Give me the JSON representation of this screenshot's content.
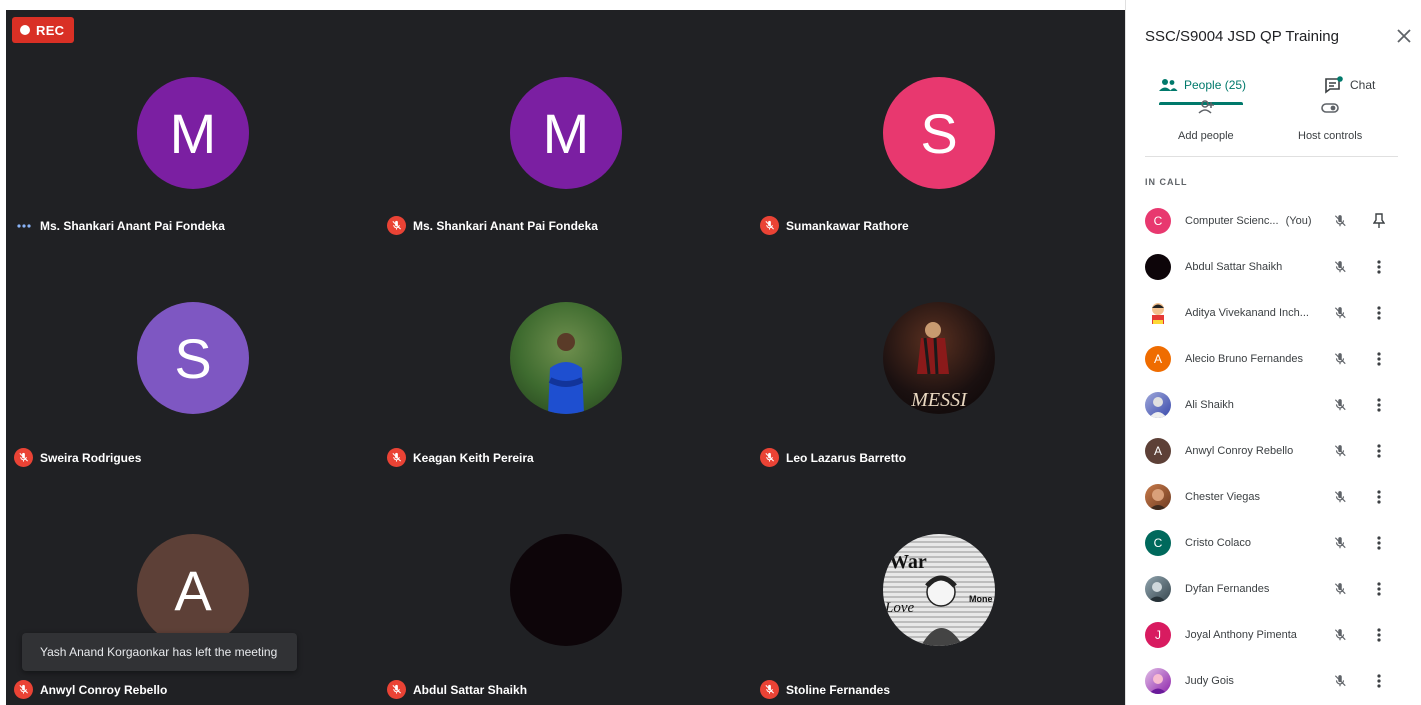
{
  "recording": {
    "label": "REC"
  },
  "tiles": [
    {
      "name": "Ms. Shankari Anant Pai Fondeka",
      "initial": "M",
      "color": "#7b1fa2",
      "status": "speaking"
    },
    {
      "name": "Ms. Shankari Anant Pai Fondeka",
      "initial": "M",
      "color": "#7b1fa2",
      "status": "muted"
    },
    {
      "name": "Sumankawar Rathore",
      "initial": "S",
      "color": "#e8386f",
      "status": "muted"
    },
    {
      "name": "Sweira Rodrigues",
      "initial": "S",
      "color": "#7e57c2",
      "status": "muted"
    },
    {
      "name": "Keagan Keith Pereira",
      "initial": "",
      "color": "#3e6b2f",
      "status": "muted",
      "photo": "person-in-blue-shirt"
    },
    {
      "name": "Leo Lazarus Barretto",
      "initial": "",
      "color": "#1a1010",
      "status": "muted",
      "photo": "messi"
    },
    {
      "name": "Anwyl Conroy Rebello",
      "initial": "A",
      "color": "#5d4037",
      "status": "muted"
    },
    {
      "name": "Abdul Sattar Shaikh",
      "initial": "",
      "color": "#0d0509",
      "status": "muted"
    },
    {
      "name": "Stoline Fernandes",
      "initial": "",
      "color": "#d9d9d9",
      "status": "muted",
      "photo": "newspaper-collage"
    }
  ],
  "messi_text": "MESSI",
  "newspaper_texts": {
    "top": "War",
    "side": "Love",
    "right": "Mone"
  },
  "toast": {
    "text": "Yash Anand Korgaonkar has left the meeting"
  },
  "panel": {
    "title": "SSC/S9004 JSD QP Training",
    "tabs": {
      "people": "People (25)",
      "chat": "Chat"
    },
    "actions": {
      "add_people": "Add people",
      "host_controls": "Host controls"
    },
    "section_title": "IN CALL",
    "people": [
      {
        "name": "Computer Scienc...",
        "suffix": "(You)",
        "initial": "C",
        "color": "#e8386f",
        "trailing": "pin"
      },
      {
        "name": "Abdul Sattar Shaikh",
        "initial": "",
        "color": "#0d0509",
        "trailing": "more"
      },
      {
        "name": "Aditya Vivekanand Inch...",
        "initial": "",
        "color": "#ffffff",
        "trailing": "more",
        "photo": "cartoon"
      },
      {
        "name": "Alecio Bruno Fernandes",
        "initial": "A",
        "color": "#ef6c00",
        "trailing": "more"
      },
      {
        "name": "Ali Shaikh",
        "initial": "",
        "color": "#5c6bc0",
        "trailing": "more",
        "photo": "portrait"
      },
      {
        "name": "Anwyl Conroy Rebello",
        "initial": "A",
        "color": "#5d4037",
        "trailing": "more"
      },
      {
        "name": "Chester Viegas",
        "initial": "",
        "color": "#8d5a3b",
        "trailing": "more",
        "photo": "portrait"
      },
      {
        "name": "Cristo Colaco",
        "initial": "C",
        "color": "#00695c",
        "trailing": "more"
      },
      {
        "name": "Dyfan Fernandes",
        "initial": "",
        "color": "#546e7a",
        "trailing": "more",
        "photo": "portrait"
      },
      {
        "name": "Joyal Anthony Pimenta",
        "initial": "J",
        "color": "#d81b60",
        "trailing": "more"
      },
      {
        "name": "Judy Gois",
        "initial": "",
        "color": "#b39ddb",
        "trailing": "more",
        "photo": "portrait"
      }
    ]
  }
}
